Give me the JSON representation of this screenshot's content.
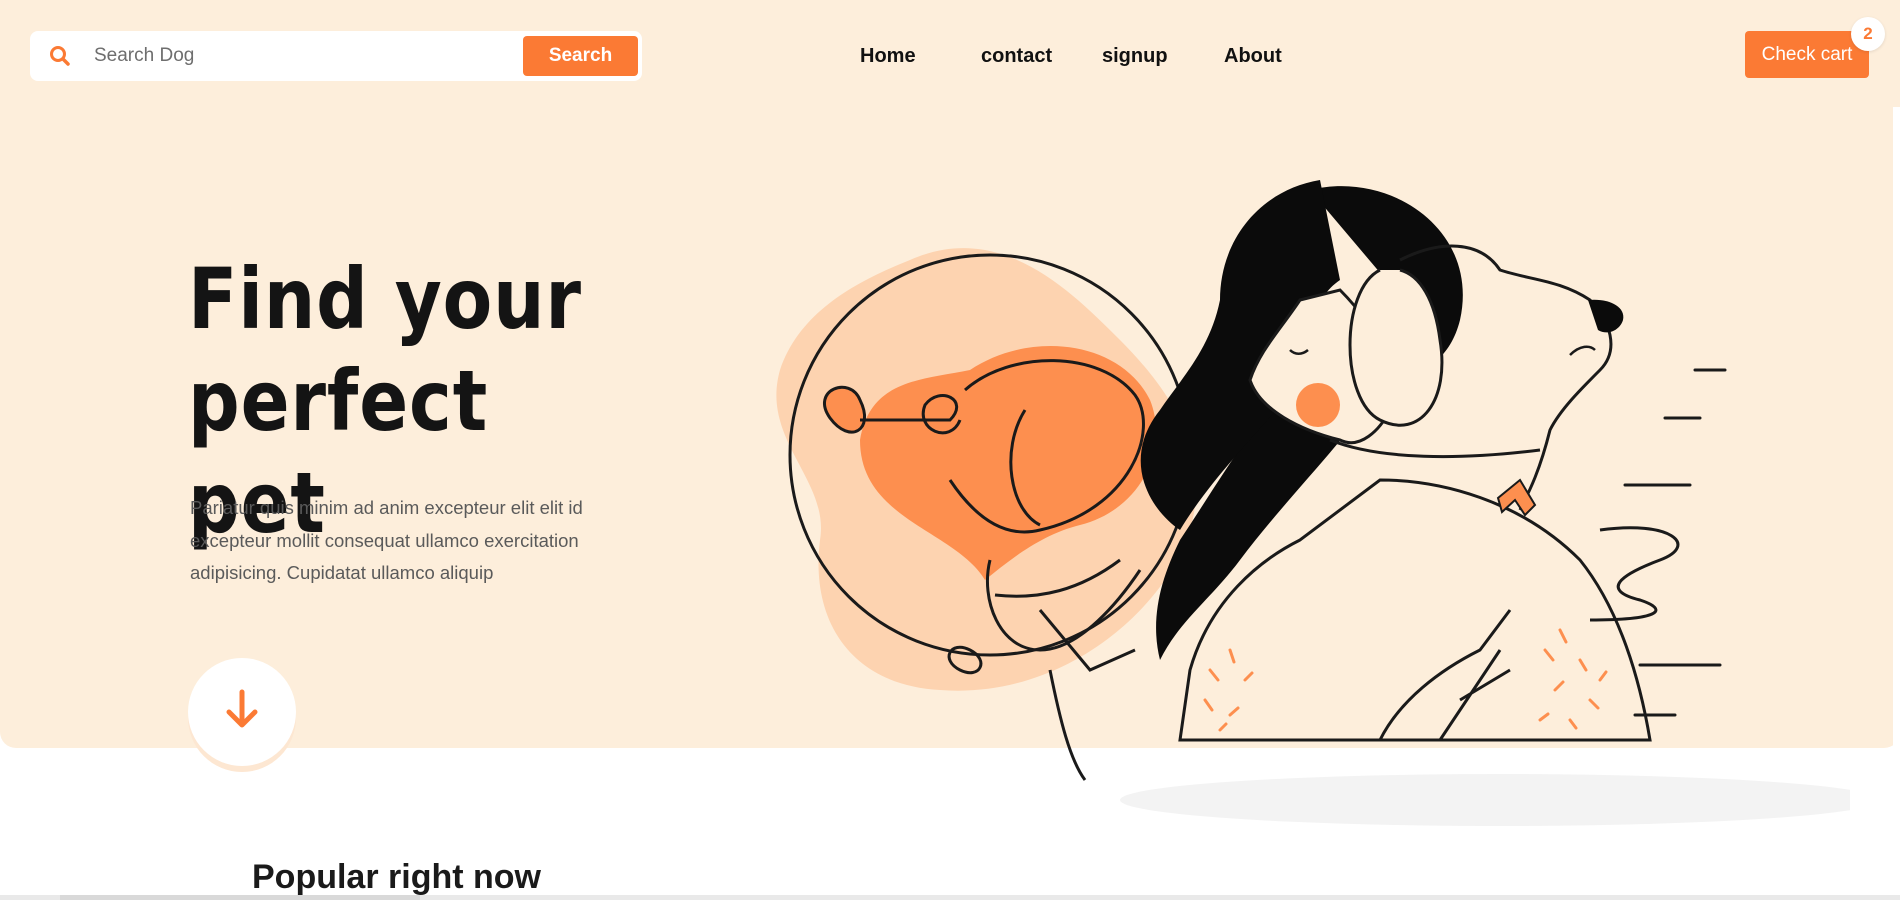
{
  "search": {
    "placeholder": "Search Dog",
    "button_label": "Search"
  },
  "nav": {
    "items": [
      {
        "label": "Home"
      },
      {
        "label": "contact"
      },
      {
        "label": "signup"
      },
      {
        "label": "About"
      }
    ]
  },
  "cart": {
    "label": "Check cart",
    "count": "2"
  },
  "hero": {
    "title_line1": "Find your",
    "title_line2": "perfect pet",
    "description": "Pariatur quis minim ad anim excepteur elit elit id excepteur mollit consequat ullamco exercitation adipisicing. Cupidatat ullamco aliquip"
  },
  "section": {
    "popular_title": "Popular right now"
  },
  "colors": {
    "accent": "#fb7a34",
    "hero_background": "#fdeedb",
    "illustration_peach": "#fdd3b0",
    "illustration_orange": "#fd8f4f"
  },
  "icons": {
    "search": "search-icon",
    "scroll_down": "arrow-down-icon"
  }
}
